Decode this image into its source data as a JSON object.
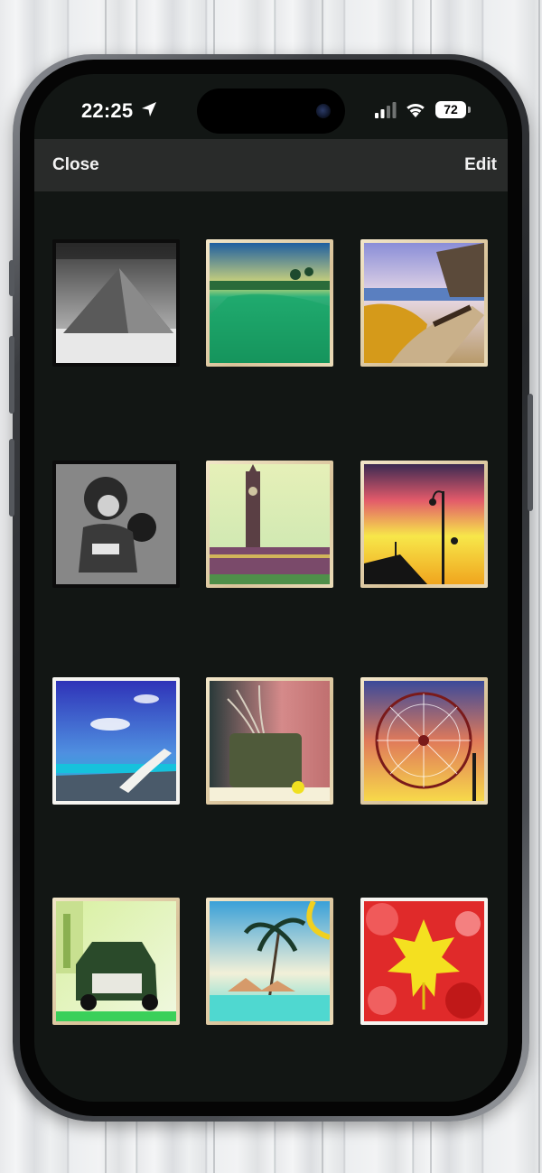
{
  "status_bar": {
    "time": "22:25",
    "battery": "72",
    "icons": [
      "location-arrow-icon",
      "cellular-signal-icon",
      "wifi-icon",
      "battery-icon"
    ]
  },
  "nav": {
    "close_label": "Close",
    "edit_label": "Edit"
  },
  "colors": {
    "screen_bg": "#121614",
    "nav_bg": "#292b2a",
    "nav_text": "#f2f2f2"
  },
  "photos": [
    {
      "subject": "pyramid"
    },
    {
      "subject": "tropical-lagoon"
    },
    {
      "subject": "coastal-path-bench"
    },
    {
      "subject": "child-football-player"
    },
    {
      "subject": "big-ben"
    },
    {
      "subject": "street-lamps-sunset"
    },
    {
      "subject": "beach-lounge-chair"
    },
    {
      "subject": "potted-plant"
    },
    {
      "subject": "ferris-wheel"
    },
    {
      "subject": "vintage-truck"
    },
    {
      "subject": "palm-trees-beach"
    },
    {
      "subject": "autumn-leaves"
    }
  ]
}
